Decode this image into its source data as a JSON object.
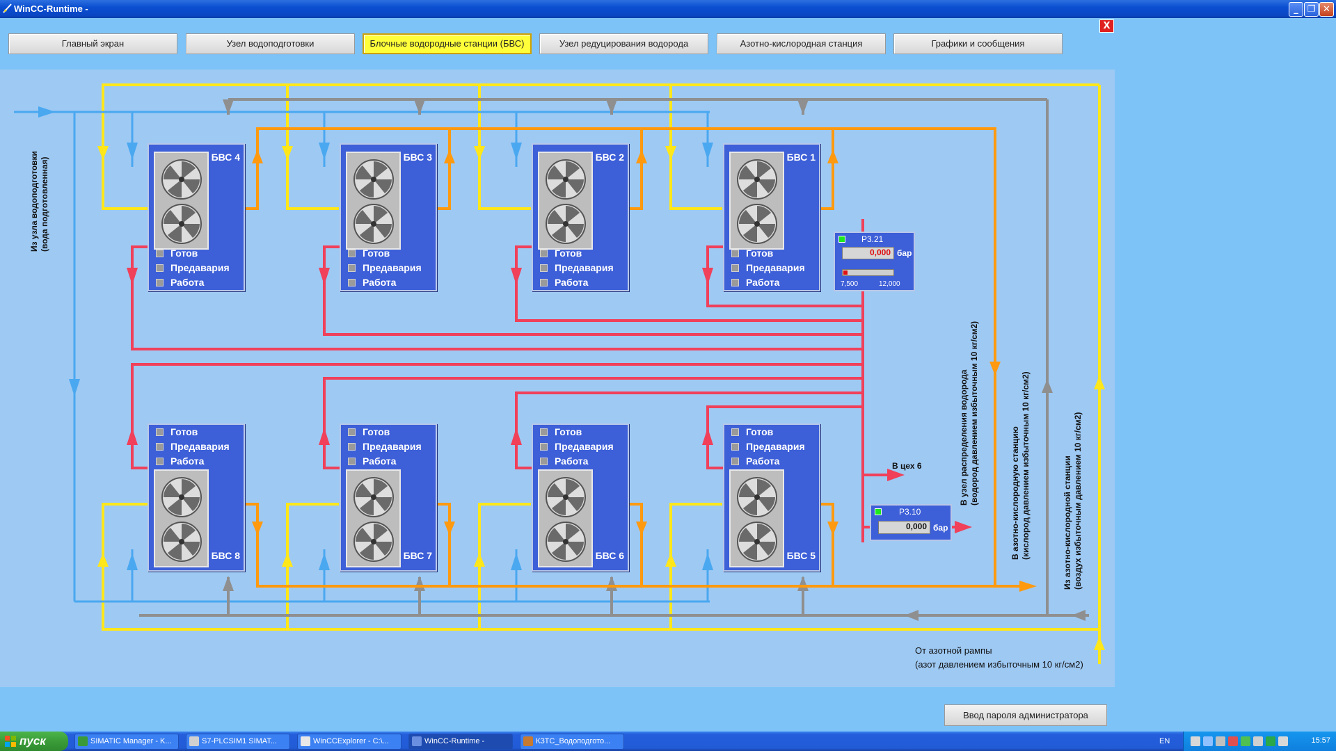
{
  "window": {
    "title": "WinCC-Runtime -"
  },
  "nav": {
    "buttons": [
      {
        "label": "Главный экран",
        "active": false
      },
      {
        "label": "Узел водоподготовки",
        "active": false
      },
      {
        "label": "Блочные водородные станции (БВС)",
        "active": true
      },
      {
        "label": "Узел редуцирования водорода",
        "active": false
      },
      {
        "label": "Азотно-кислородная станция",
        "active": false
      },
      {
        "label": "Графики и сообщения",
        "active": false
      }
    ],
    "close_label": "X"
  },
  "status_labels": {
    "ready": "Готов",
    "prealarm": "Предавария",
    "work": "Работа"
  },
  "stations": {
    "s4": "БВС 4",
    "s3": "БВС 3",
    "s2": "БВС 2",
    "s1": "БВС 1",
    "s8": "БВС 8",
    "s7": "БВС 7",
    "s6": "БВС 6",
    "s5": "БВС 5"
  },
  "gauges": {
    "p321": {
      "name": "P3.21",
      "value": "0,000",
      "unit": "бар",
      "min": "7,500",
      "max": "12,000"
    },
    "p310": {
      "name": "P3.10",
      "value": "0,000",
      "unit": "бар"
    }
  },
  "labels": {
    "inlet_line1": "Из узла водоподготовки",
    "inlet_line2": "(вода подготовленная)",
    "to_shop": "В цех 6",
    "h2_line1": "В узел распределения водорода",
    "h2_line2": "(водород давлением избыточным 10 кг/см2)",
    "o2_line1": "В азотно-кислородную станцию",
    "o2_line2": "(кислород давлением избыточным 10 кг/см2)",
    "air_line1": "Из азотно-кислородной станции",
    "air_line2": "(воздух избыточным давлением 10 кг/см2)",
    "n2_line1": "От азотной рампы",
    "n2_line2": "(азот давлением избыточным 10 кг/см2)"
  },
  "admin_button": "Ввод пароля администратора",
  "taskbar": {
    "start": "пуск",
    "tasks": [
      "SIMATIC Manager - K...",
      "S7-PLCSIM1    SIMAT...",
      "WinCCExplorer - C:\\...",
      "WinCC-Runtime -",
      "КЗТС_Водоподгото..."
    ],
    "lang": "EN",
    "clock": "15:57"
  },
  "colors": {
    "water": "#4aa8f0",
    "yellow": "#ffe71a",
    "gray": "#8f8f8f",
    "orange": "#ff9a10",
    "red": "#f0405a",
    "unit_blue": "#3d5fd8",
    "panel": "#9ec9f3",
    "background": "#7ec3f7"
  }
}
